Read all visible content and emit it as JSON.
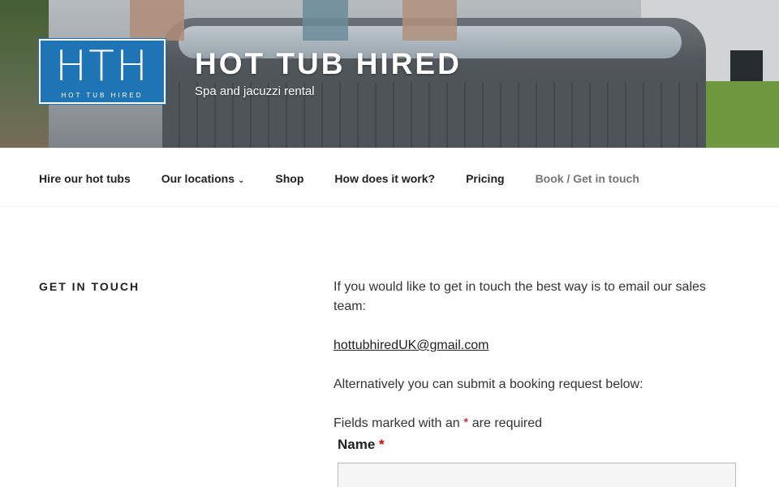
{
  "logo": {
    "initials": "HTH",
    "tagline": "HOT TUB HIRED"
  },
  "site": {
    "title": "HOT TUB HIRED",
    "description": "Spa and jacuzzi rental"
  },
  "nav": {
    "items": [
      {
        "label": "Hire our hot tubs"
      },
      {
        "label": "Our locations"
      },
      {
        "label": "Shop"
      },
      {
        "label": "How does it work?"
      },
      {
        "label": "Pricing"
      },
      {
        "label": "Book / Get in touch"
      }
    ]
  },
  "page": {
    "section_title": "GET IN TOUCH",
    "intro": "If you would like to get in touch the best way is to email our sales team:",
    "email": "hottubhiredUK@gmail.com",
    "alt_text": "Alternatively you can submit a booking request below:",
    "required_prefix": "Fields marked with an",
    "required_star": "*",
    "required_suffix": "are required"
  },
  "form": {
    "name_label": "Name",
    "required_star": "*"
  },
  "colors": {
    "logo_bg": "#1f74b5",
    "required": "#c00000",
    "nav_muted": "#767676"
  }
}
